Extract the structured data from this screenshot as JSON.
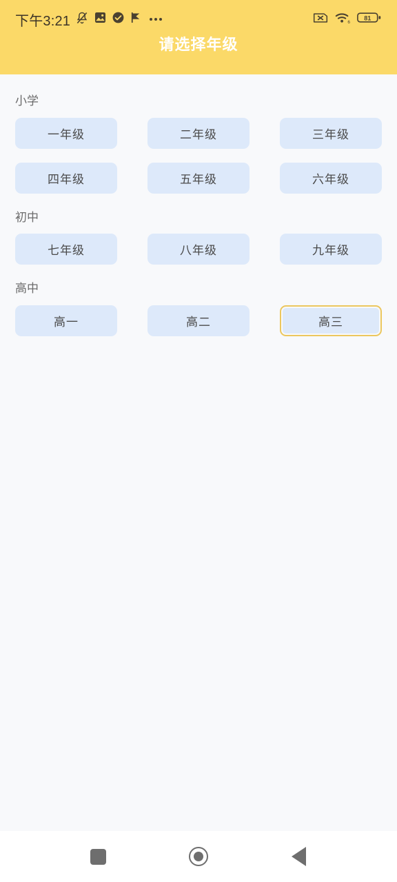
{
  "statusbar": {
    "time": "下午3:21",
    "left_icons": [
      "bell-muted-icon",
      "image-download-icon",
      "check-circle-icon",
      "flag-play-icon",
      "more-dots-icon"
    ],
    "right_icons": [
      "sim-card-off-icon",
      "wifi-6-icon",
      "battery-icon"
    ],
    "wifi_label": "6",
    "battery_level": "81"
  },
  "header": {
    "title": "请选择年级",
    "background": "#fbd968",
    "title_color": "#ffffff"
  },
  "theme": {
    "content_background": "#f8f9fb",
    "chip_background": "#dde9fa",
    "chip_text": "#4a4a4a",
    "selected_border": "#ecc75e",
    "section_title_color": "#6b6b6b"
  },
  "sections": [
    {
      "title": "小学",
      "grades": [
        {
          "label": "一年级",
          "selected": false
        },
        {
          "label": "二年级",
          "selected": false
        },
        {
          "label": "三年级",
          "selected": false
        },
        {
          "label": "四年级",
          "selected": false
        },
        {
          "label": "五年级",
          "selected": false
        },
        {
          "label": "六年级",
          "selected": false
        }
      ]
    },
    {
      "title": "初中",
      "grades": [
        {
          "label": "七年级",
          "selected": false
        },
        {
          "label": "八年级",
          "selected": false
        },
        {
          "label": "九年级",
          "selected": false
        }
      ]
    },
    {
      "title": "高中",
      "grades": [
        {
          "label": "高一",
          "selected": false
        },
        {
          "label": "高二",
          "selected": false
        },
        {
          "label": "高三",
          "selected": true
        }
      ]
    }
  ],
  "navbar": {
    "recents_label": "recents",
    "home_label": "home",
    "back_label": "back"
  }
}
